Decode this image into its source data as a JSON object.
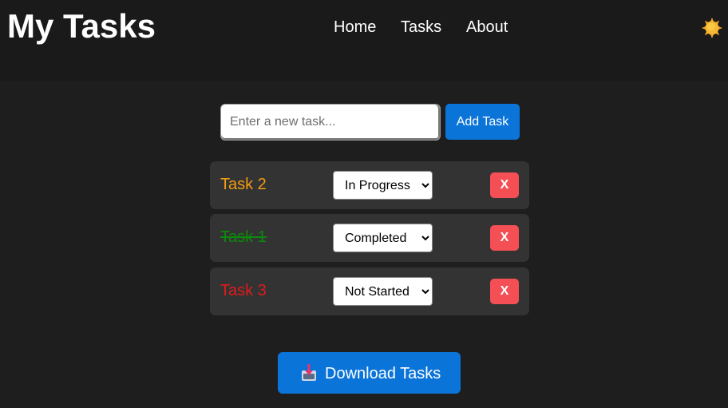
{
  "header": {
    "title": "My Tasks",
    "nav": [
      {
        "label": "Home"
      },
      {
        "label": "Tasks"
      },
      {
        "label": "About"
      }
    ],
    "theme_toggle_icon": "sun-icon"
  },
  "new_task": {
    "placeholder": "Enter a new task...",
    "value": "",
    "add_label": "Add Task"
  },
  "tasks": [
    {
      "name": "Task 2",
      "status": "In Progress",
      "color": "#f39c12",
      "completed": false,
      "delete_label": "X"
    },
    {
      "name": "Task 1",
      "status": "Completed",
      "color": "#0b8a0b",
      "completed": true,
      "delete_label": "X"
    },
    {
      "name": "Task 3",
      "status": "Not Started",
      "color": "#e01b1b",
      "completed": false,
      "delete_label": "X"
    }
  ],
  "status_options": [
    "Not Started",
    "In Progress",
    "Completed"
  ],
  "download": {
    "icon": "download-icon",
    "label": "Download Tasks"
  },
  "colors": {
    "background": "#1e1e1e",
    "header": "#1a1a1a",
    "row": "#333333",
    "accent": "#0a74d9",
    "danger": "#f44f55"
  }
}
